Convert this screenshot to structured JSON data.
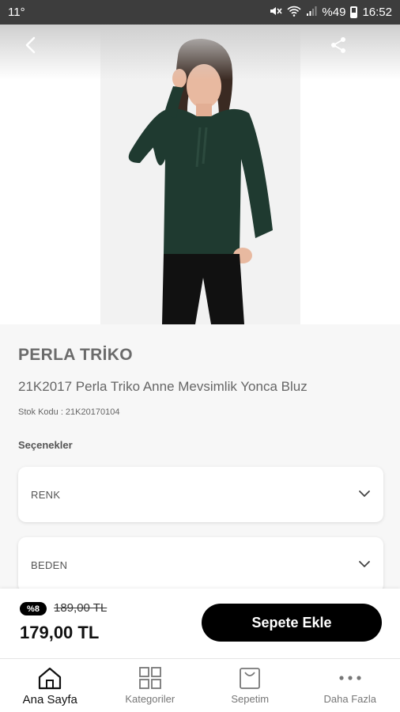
{
  "status_bar": {
    "left_text": "11°",
    "battery": "%49",
    "time": "16:52"
  },
  "product": {
    "brand": "PERLA TRİKO",
    "title": "21K2017 Perla Triko Anne Mevsimlik Yonca Bluz",
    "stock_code": "Stok Kodu : 21K20170104",
    "options_label": "Seçenekler",
    "options": [
      {
        "label": "RENK"
      },
      {
        "label": "BEDEN"
      }
    ],
    "image": {
      "description_icon": "product-photo",
      "sweater_color": "#1f3a30"
    }
  },
  "price": {
    "discount_badge": "%8",
    "old_price": "189,00 TL",
    "new_price": "179,00 TL",
    "add_to_cart": "Sepete Ekle"
  },
  "tabs": [
    {
      "label": "Ana Sayfa",
      "icon": "home-icon",
      "active": true
    },
    {
      "label": "Kategoriler",
      "icon": "grid-icon",
      "active": false
    },
    {
      "label": "Sepetim",
      "icon": "cart-icon",
      "active": false
    },
    {
      "label": "Daha Fazla",
      "icon": "more-icon",
      "active": false
    }
  ],
  "colors": {
    "accent": "#000000",
    "background": "#f7f7f7",
    "status_bar": "#3d3d3d"
  }
}
